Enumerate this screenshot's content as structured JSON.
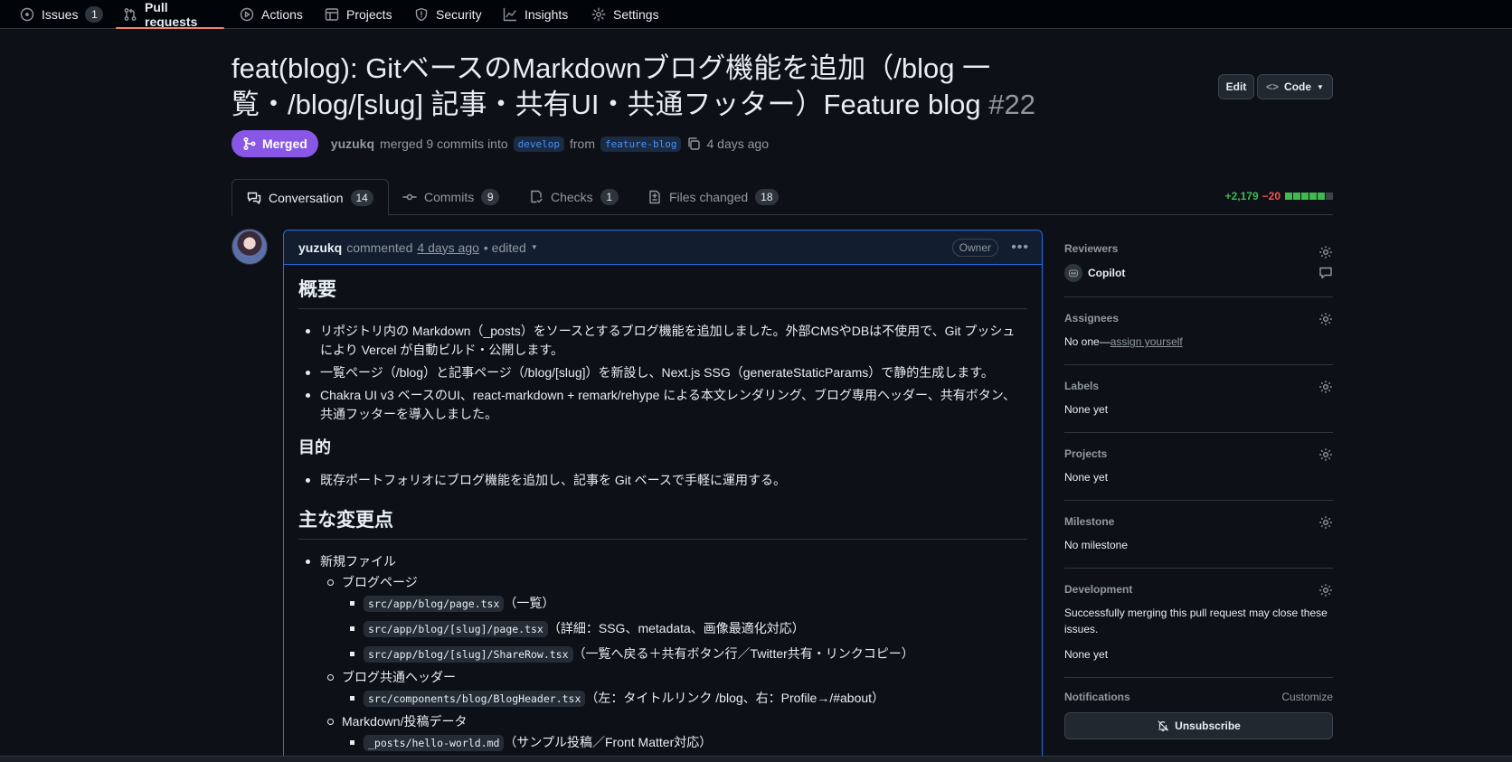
{
  "repo_nav": {
    "items": [
      {
        "label": "Issues",
        "count": "1",
        "icon": "issue-opened-icon"
      },
      {
        "label": "Pull requests",
        "icon": "git-pull-request-icon",
        "selected": true
      },
      {
        "label": "Actions",
        "icon": "play-icon"
      },
      {
        "label": "Projects",
        "icon": "table-icon"
      },
      {
        "label": "Security",
        "icon": "shield-icon"
      },
      {
        "label": "Insights",
        "icon": "graph-icon"
      },
      {
        "label": "Settings",
        "icon": "gear-icon"
      }
    ]
  },
  "pr": {
    "title": "feat(blog): GitベースのMarkdownブログ機能を追加（/blog 一覧・/blog/[slug] 記事・共有UI・共通フッター）Feature blog",
    "number": "#22",
    "edit_label": "Edit",
    "code_label": "Code",
    "state": "Merged",
    "author": "yuzukq",
    "merged_text": "merged 9 commits into",
    "base_branch": "develop",
    "from_text": "from",
    "head_branch": "feature-blog",
    "time": "4 days ago"
  },
  "tabs": [
    {
      "label": "Conversation",
      "count": "14",
      "icon": "comment-discussion-icon"
    },
    {
      "label": "Commits",
      "count": "9",
      "icon": "git-commit-icon"
    },
    {
      "label": "Checks",
      "count": "1",
      "icon": "checklist-icon"
    },
    {
      "label": "Files changed",
      "count": "18",
      "icon": "file-diff-icon"
    }
  ],
  "diffstat": {
    "additions": "+2,179",
    "deletions": "−20",
    "blocks": [
      "green",
      "green",
      "green",
      "green",
      "green",
      "gray"
    ]
  },
  "comment": {
    "author": "yuzukq",
    "verb": "commented",
    "when": "4 days ago",
    "edited": "• edited",
    "role": "Owner",
    "h_overview": "概要",
    "overview": [
      "リポジトリ内の Markdown（_posts）をソースとするブログ機能を追加しました。外部CMSやDBは不使用で、Git プッシュにより Vercel が自動ビルド・公開します。",
      "一覧ページ（/blog）と記事ページ（/blog/[slug]）を新設し、Next.js SSG（generateStaticParams）で静的生成します。",
      "Chakra UI v3 ベースのUI、react-markdown + remark/rehype による本文レンダリング、ブログ専用ヘッダー、共有ボタン、共通フッターを導入しました。"
    ],
    "h_purpose": "目的",
    "purpose": [
      "既存ポートフォリオにブログ機能を追加し、記事を Git ベースで手軽に運用する。"
    ],
    "h_changes": "主な変更点",
    "new_files": "新規ファイル",
    "blog_pages": "ブログページ",
    "files1": [
      {
        "code": "src/app/blog/page.tsx",
        "desc": "（一覧）"
      },
      {
        "code": "src/app/blog/[slug]/page.tsx",
        "desc": "（詳細：SSG、metadata、画像最適化対応）"
      },
      {
        "code": "src/app/blog/[slug]/ShareRow.tsx",
        "desc": "（一覧へ戻る＋共有ボタン行／Twitter共有・リンクコピー）"
      }
    ],
    "blog_header": "ブログ共通ヘッダー",
    "files2": [
      {
        "code": "src/components/blog/BlogHeader.tsx",
        "desc": "（左：タイトルリンク /blog、右：Profile→/#about）"
      }
    ],
    "markdown_data": "Markdown/投稿データ",
    "files3": [
      {
        "code": "_posts/hello-world.md",
        "desc": "（サンプル投稿／Front Matter対応）"
      }
    ]
  },
  "sidebar": {
    "reviewers_label": "Reviewers",
    "reviewer_name": "Copilot",
    "assignees_label": "Assignees",
    "assignees_none": "No one—",
    "assign_yourself": "assign yourself",
    "labels_label": "Labels",
    "labels_value": "None yet",
    "projects_label": "Projects",
    "projects_value": "None yet",
    "milestone_label": "Milestone",
    "milestone_value": "No milestone",
    "development_label": "Development",
    "development_text": "Successfully merging this pull request may close these issues.",
    "development_value": "None yet",
    "notifications_label": "Notifications",
    "customize_label": "Customize",
    "unsubscribe_label": "Unsubscribe"
  },
  "colors": {
    "merged": "#8957e5",
    "accent": "#1f6feb",
    "additions": "#3fb950",
    "deletions": "#f85149"
  }
}
